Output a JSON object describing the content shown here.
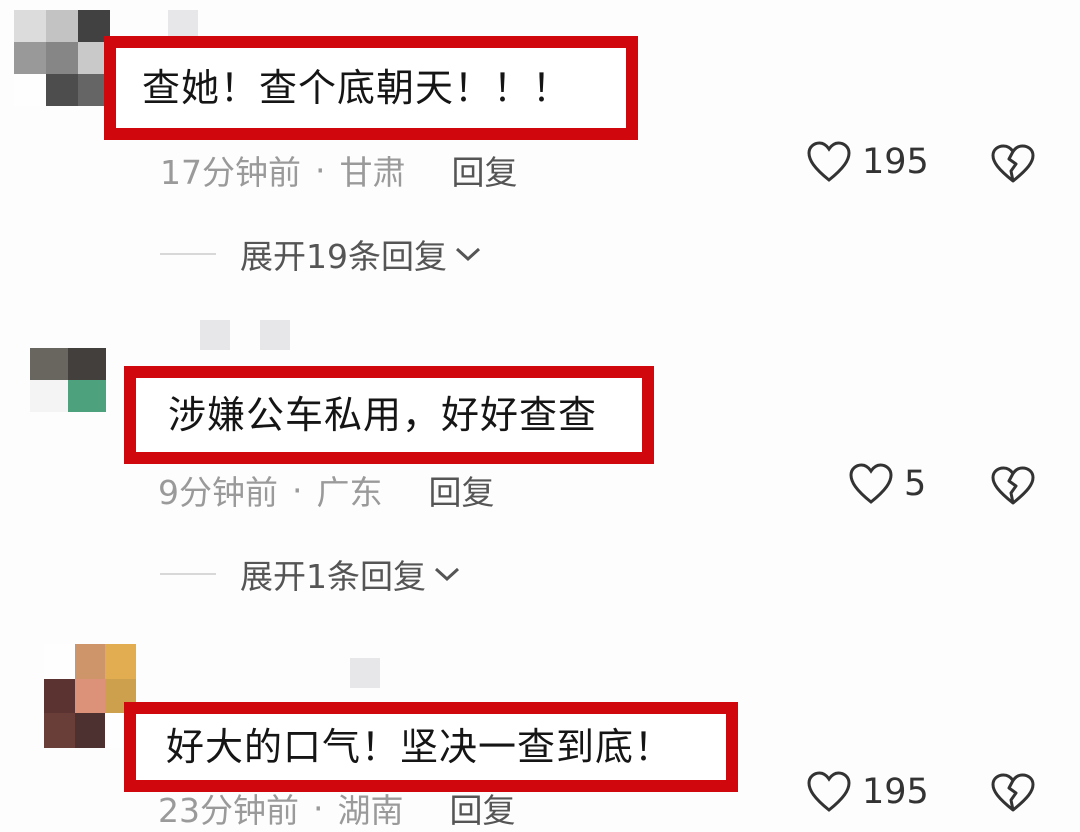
{
  "comments": [
    {
      "text": "查她！查个底朝天！！！",
      "time": "17分钟前",
      "separator": "·",
      "location": "甘肃",
      "reply_label": "回复",
      "likes": "195",
      "expand_label": "展开19条回复"
    },
    {
      "text": "涉嫌公车私用，好好查查",
      "time": "9分钟前",
      "separator": "·",
      "location": "广东",
      "reply_label": "回复",
      "likes": "5",
      "expand_label": "展开1条回复"
    },
    {
      "text": "好大的口气！坚决一查到底！",
      "time": "23分钟前",
      "separator": "·",
      "location": "湖南",
      "reply_label": "回复",
      "likes": "195"
    }
  ],
  "colors": {
    "highlight_border": "#d0070d",
    "meta_text": "#9a9a9a",
    "action_text": "#555555"
  },
  "icons": {
    "like": "heart-outline-icon",
    "dislike": "broken-heart-icon",
    "expand": "chevron-down-icon"
  }
}
